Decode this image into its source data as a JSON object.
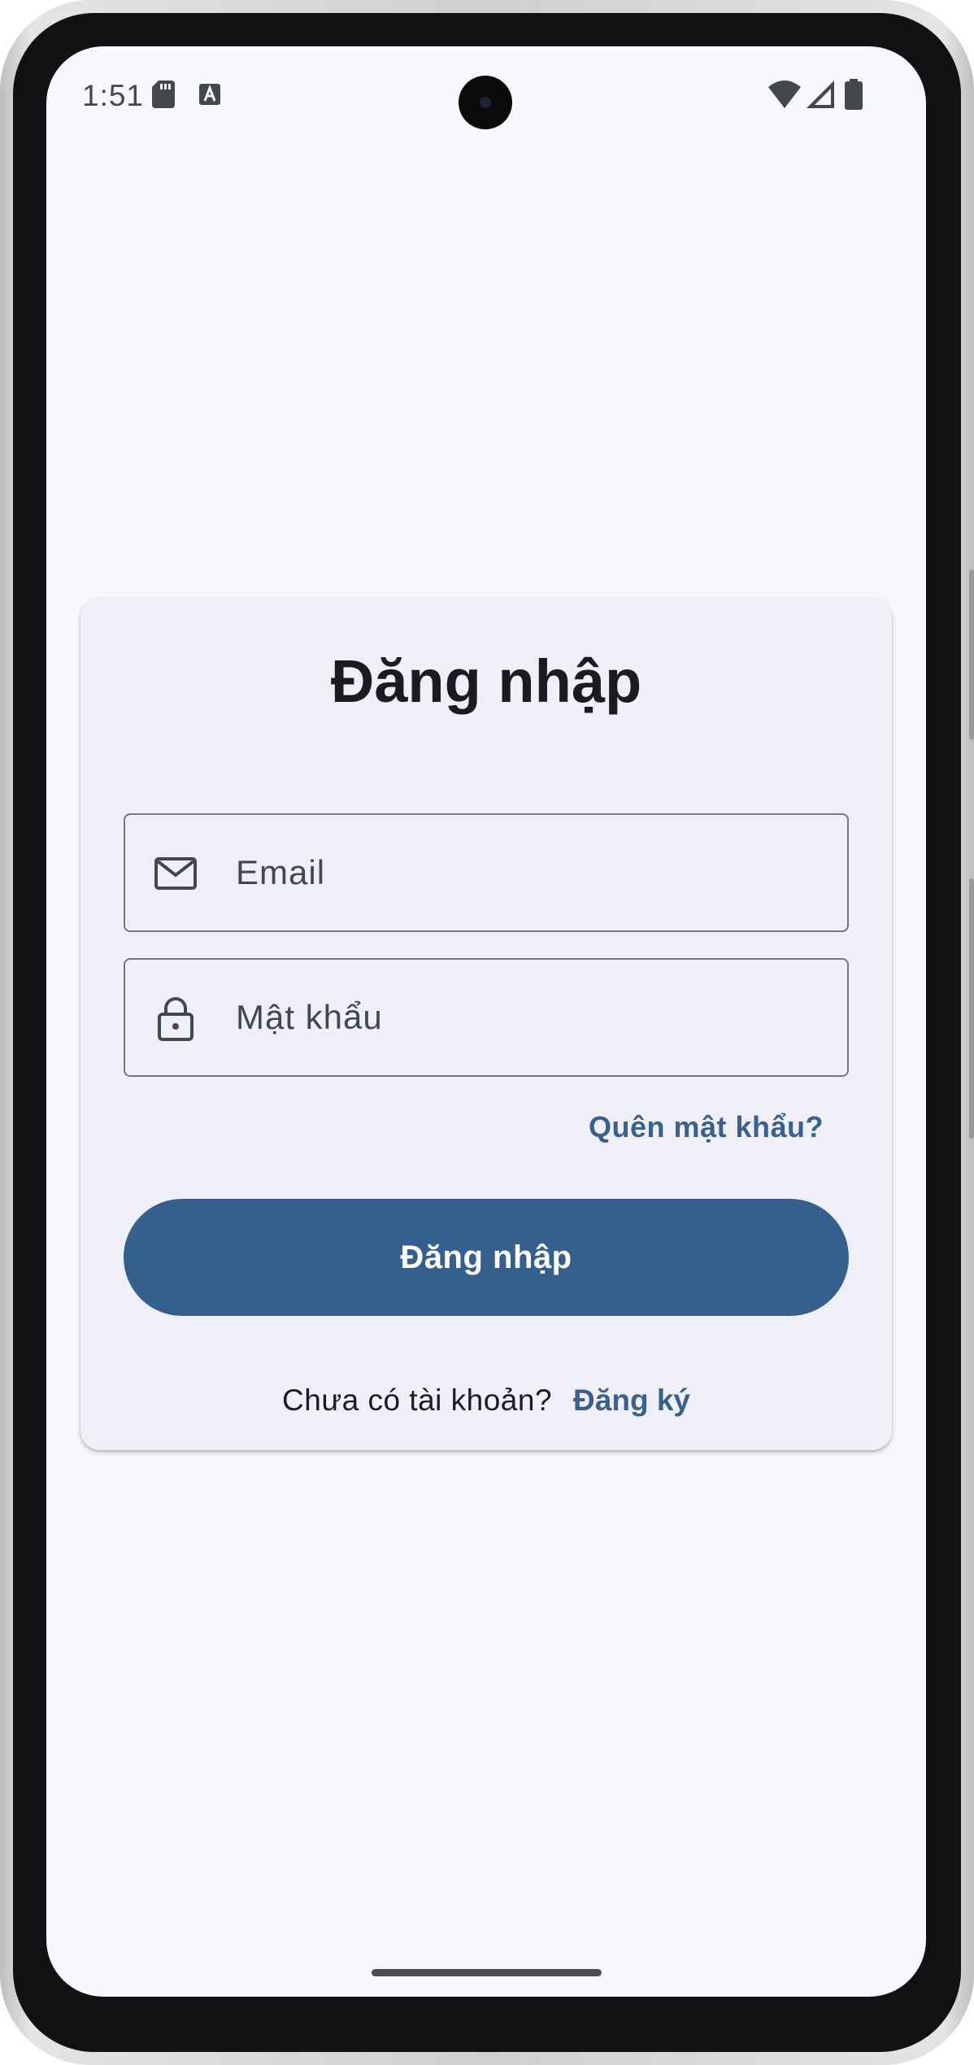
{
  "status_bar": {
    "time": "1:51",
    "icons": [
      "sd-card-icon",
      "text-a-icon",
      "wifi-icon",
      "signal-icon",
      "battery-icon"
    ]
  },
  "login_card": {
    "title": "Đăng nhập",
    "email_field": {
      "placeholder": "Email",
      "value": "",
      "icon": "mail-icon"
    },
    "password_field": {
      "placeholder": "Mật khẩu",
      "value": "",
      "icon": "lock-icon"
    },
    "forgot_password_label": "Quên mật khẩu?",
    "login_button_label": "Đăng nhập",
    "signup_prompt": "Chưa có tài khoản?",
    "signup_link_label": "Đăng ký"
  },
  "colors": {
    "screen_background": "#f7f8fc",
    "card_background": "#eff0f7",
    "primary": "#35608e",
    "link": "#3a6090",
    "text": "#1b1c20",
    "outline": "#74777f"
  }
}
